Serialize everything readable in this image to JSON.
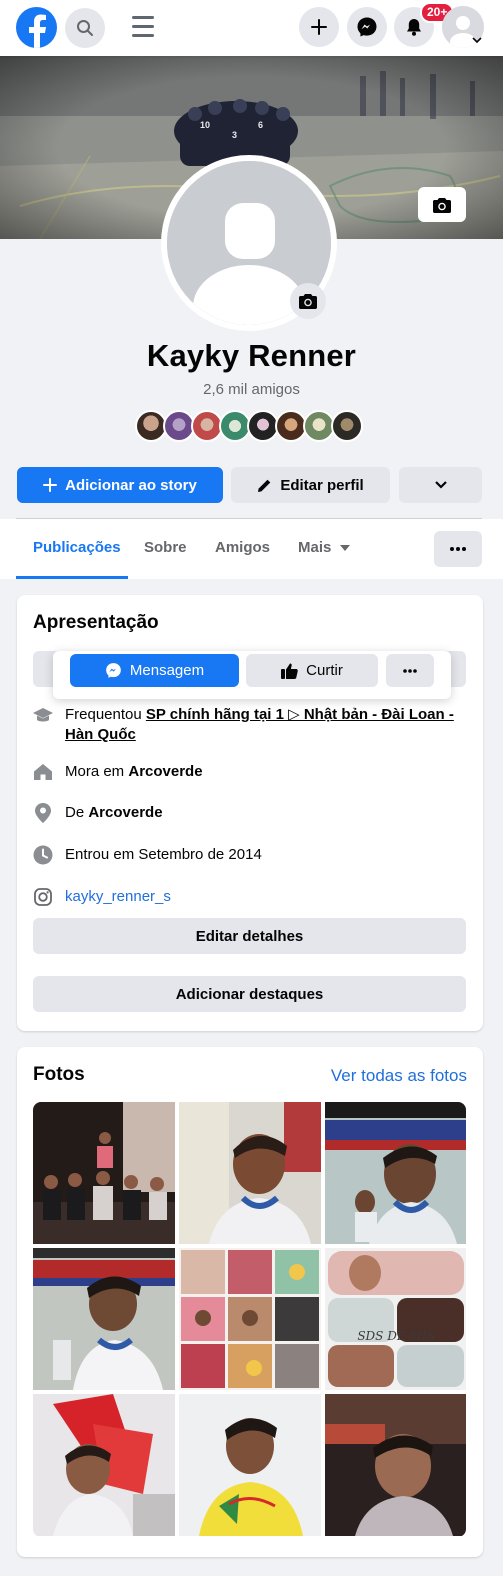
{
  "topbar": {
    "notif_badge": "20+"
  },
  "icons": {
    "logo": "facebook-logo",
    "search": "search-icon",
    "menu": "hamburger-icon",
    "create": "plus-icon",
    "messenger": "messenger-icon",
    "notifications": "bell-icon",
    "account": "chevron-down-icon"
  },
  "profile": {
    "name": "Kayky Renner",
    "friends_count": "2,6 mil amigos"
  },
  "actions": {
    "add_story": "Adicionar ao story",
    "edit_profile": "Editar perfil"
  },
  "tabs": [
    "Publicações",
    "Sobre",
    "Amigos",
    "Mais"
  ],
  "intro": {
    "title": "Apresentação",
    "popup": {
      "message": "Mensagem",
      "like": "Curtir"
    },
    "studied_prefix": "Frequentou ",
    "studied_place": "SP chính hãng tại 1 ▷ Nhật bản - Đài Loan - Hàn Quốc",
    "lives_prefix": "Mora em ",
    "lives_place": "Arcoverde",
    "from_prefix": "De ",
    "from_place": "Arcoverde",
    "joined": "Entrou em Setembro de 2014",
    "instagram": "kayky_renner_s",
    "edit_details": "Editar detalhes",
    "add_featured": "Adicionar destaques"
  },
  "photos": {
    "title": "Fotos",
    "see_all": "Ver todas as fotos",
    "collage_text": "SDS DE MIS"
  },
  "colors": {
    "brand_blue": "#1877f2",
    "badge_red": "#e41e3f",
    "button_gray": "#e4e6eb",
    "background": "#f0f2f5"
  }
}
